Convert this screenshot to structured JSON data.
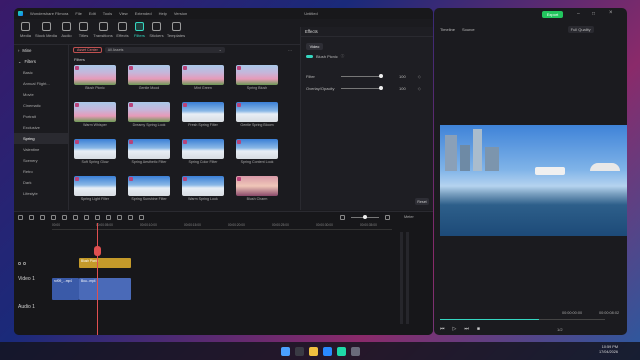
{
  "app": {
    "title_menu": [
      "Wondershare Filmora",
      "File",
      "Edit",
      "Tools",
      "View",
      "Extended",
      "Help",
      "Version"
    ],
    "doc_title": "Untitled",
    "export_label": "Export"
  },
  "toolbar": {
    "tools": [
      "Media",
      "Stock Media",
      "Audio",
      "Titles",
      "Transitions",
      "Effects",
      "Filters",
      "Stickers",
      "Templates"
    ],
    "active_index": 6
  },
  "sidebar": {
    "mine_label": "Mine",
    "filters_label": "Filters",
    "items": [
      "Basic",
      "Annual Flight...",
      "Movie",
      "Cinematic",
      "Portrait",
      "Exclusive",
      "Spring",
      "Valentine",
      "Scenery",
      "Retro",
      "Dark",
      "Lifestyle"
    ],
    "selected_index": 6
  },
  "library": {
    "pill_label": "Asset Center",
    "dropdown_label": "All Assets",
    "section_label": "Filters",
    "cards": [
      {
        "name": "Blush Picnic",
        "style": "flower"
      },
      {
        "name": "Gentle Mood",
        "style": "flower"
      },
      {
        "name": "Mint Green",
        "style": "flower"
      },
      {
        "name": "Spring Blush",
        "style": "flower"
      },
      {
        "name": "Warm Whisper",
        "style": "flower"
      },
      {
        "name": "Dreamy Spring Look",
        "style": "flower"
      },
      {
        "name": "Fresh Spring Filter",
        "style": "sky"
      },
      {
        "name": "Gentle Spring Bloom",
        "style": "sky"
      },
      {
        "name": "Soft Spring Glow",
        "style": "sky"
      },
      {
        "name": "Spring Aesthetic Filter",
        "style": "sky"
      },
      {
        "name": "Spring Color Filter",
        "style": "sky"
      },
      {
        "name": "Spring Content Look",
        "style": "sky"
      },
      {
        "name": "Spring Light Filter",
        "style": "sky"
      },
      {
        "name": "Spring Sunshine Filter",
        "style": "sky"
      },
      {
        "name": "Warm Spring Look",
        "style": "sky"
      },
      {
        "name": "Blush Charm",
        "style": "girl"
      }
    ]
  },
  "props": {
    "header": "Effects",
    "tab": "Video",
    "effect_name": "Blush Picnic",
    "filter_label": "Filter",
    "filter_value": "100",
    "filter_level": 1.0,
    "opacity_label": "Overlay/Opacity",
    "opacity_value": "100",
    "opacity_level": 1.0,
    "reset_label": "Reset"
  },
  "timeline": {
    "ticks": [
      "00:00",
      "00:00:05:00",
      "00:00:10:00",
      "00:00:15:00",
      "00:00:20:00",
      "00:00:25:00",
      "00:00:30:00",
      "00:00:35:00"
    ],
    "meter_label": "Meter",
    "filter_clip": "Blush Picnic",
    "video_clip_1": "rof09_...mp4",
    "video_clip_2": "Bou...mp4",
    "track_video": "Video 1",
    "track_audio": "Audio 1"
  },
  "preview": {
    "tab_timeline": "Timeline",
    "tab_source": "Source",
    "quality": "Full Quality",
    "time_current": "00:00:00:00",
    "time_total": "00:00:08:02",
    "zoom_label": "1/2",
    "playback_progress": 0.6
  },
  "taskbar": {
    "time": "10:59 PM",
    "date": "17/04/2026"
  },
  "colors": {
    "accent": "#35d6c0",
    "playhead": "#e05050",
    "export_btn": "#22c55e",
    "filter_clip": "#c49a2a",
    "video_clip": "#3a5aa8"
  }
}
